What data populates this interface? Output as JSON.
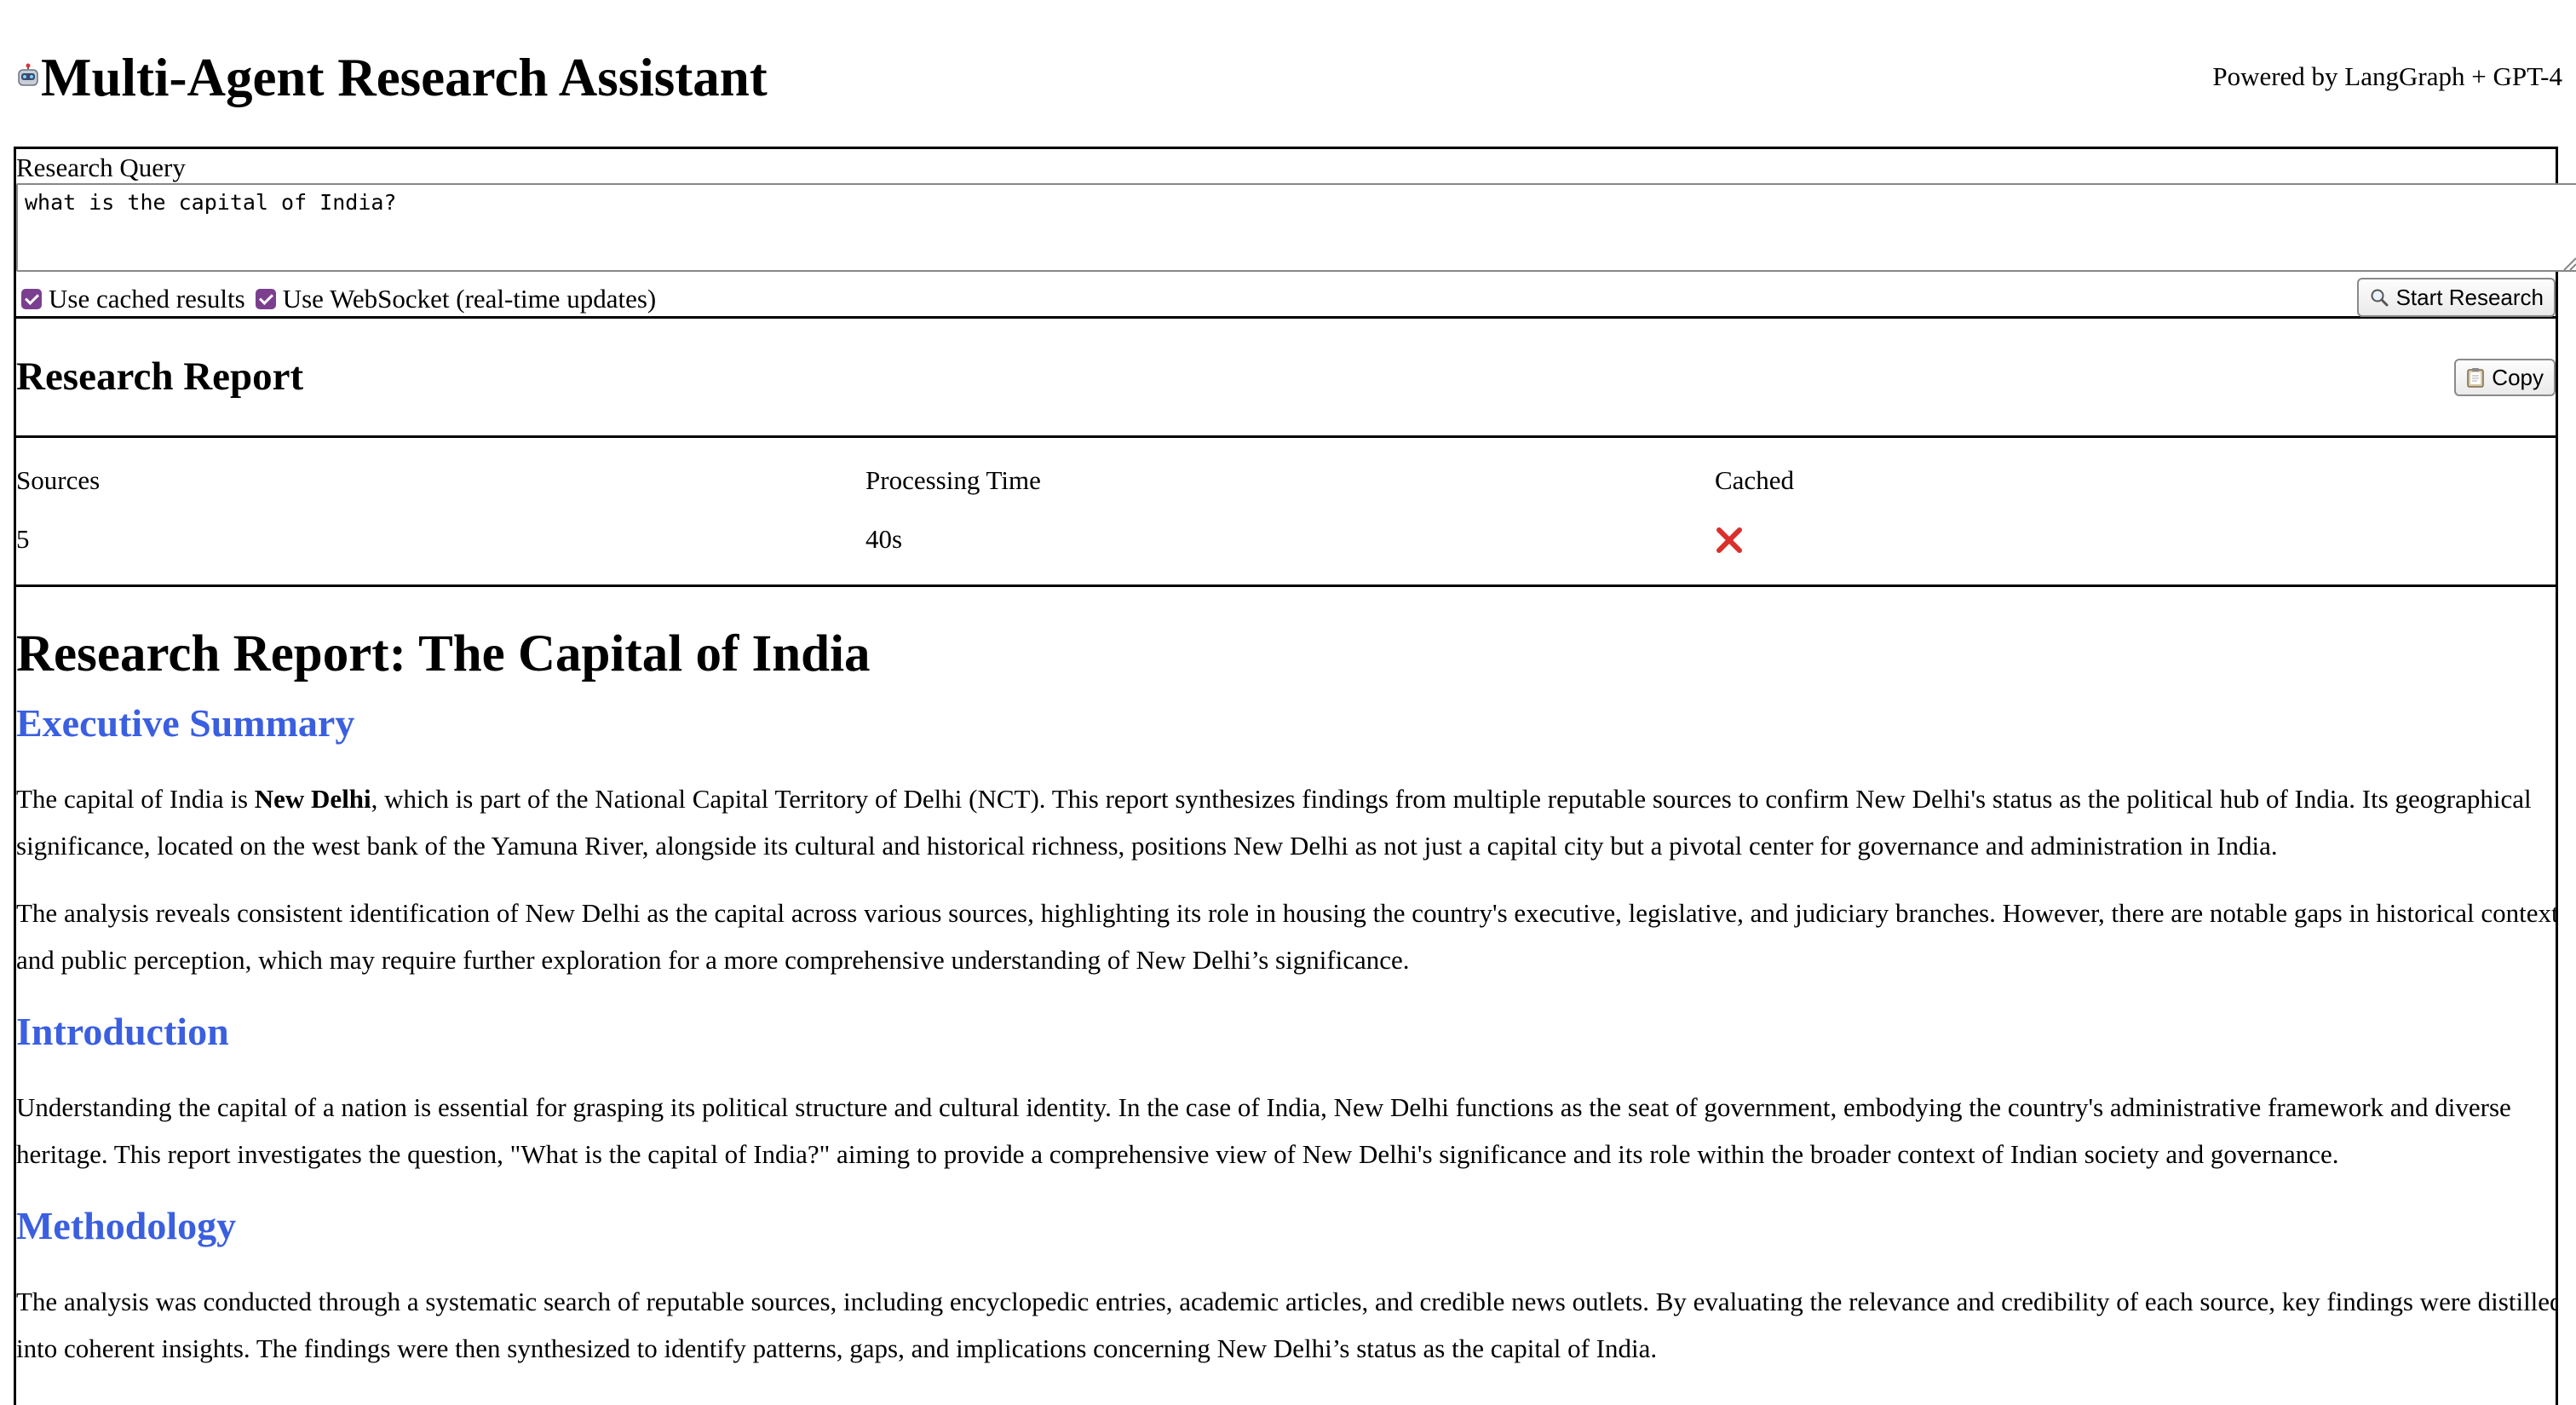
{
  "header": {
    "logo": "robot-icon",
    "title": "Multi-Agent Research Assistant",
    "powered_by": "Powered by LangGraph + GPT-4"
  },
  "query": {
    "label": "Research Query",
    "value": "what is the capital of India?",
    "options": [
      {
        "label": "Use cached results",
        "checked": true
      },
      {
        "label": "Use WebSocket (real-time updates)",
        "checked": true
      }
    ],
    "submit_label": "Start Research",
    "submit_icon": "magnifier-icon"
  },
  "report_header": {
    "title": "Research Report",
    "copy_label": "Copy",
    "copy_icon": "clipboard-icon"
  },
  "stats": {
    "sources_label": "Sources",
    "sources_value": "5",
    "time_label": "Processing Time",
    "time_value": "40s",
    "cached_label": "Cached",
    "cached_icon": "cross-mark-icon",
    "cached_color": "#d9302c"
  },
  "report": {
    "title": "Research Report: The Capital of India",
    "accent_color": "#3a5fe0",
    "sections": [
      {
        "heading": "Executive Summary",
        "paragraphs": [
          {
            "before": "The capital of India is ",
            "bold": "New Delhi",
            "after": ", which is part of the National Capital Territory of Delhi (NCT). This report synthesizes findings from multiple reputable sources to confirm New Delhi's status as the political hub of India. Its geographical significance, located on the west bank of the Yamuna River, alongside its cultural and historical richness, positions New Delhi as not just a capital city but a pivotal center for governance and administration in India."
          },
          {
            "text": "The analysis reveals consistent identification of New Delhi as the capital across various sources, highlighting its role in housing the country's executive, legislative, and judiciary branches. However, there are notable gaps in historical context and public perception, which may require further exploration for a more comprehensive understanding of New Delhi’s significance."
          }
        ]
      },
      {
        "heading": "Introduction",
        "paragraphs": [
          {
            "text": "Understanding the capital of a nation is essential for grasping its political structure and cultural identity. In the case of India, New Delhi functions as the seat of government, embodying the country's administrative framework and diverse heritage. This report investigates the question, \"What is the capital of India?\" aiming to provide a comprehensive view of New Delhi's significance and its role within the broader context of Indian society and governance."
          }
        ]
      },
      {
        "heading": "Methodology",
        "paragraphs": [
          {
            "text": "The analysis was conducted through a systematic search of reputable sources, including encyclopedic entries, academic articles, and credible news outlets. By evaluating the relevance and credibility of each source, key findings were distilled into coherent insights. The findings were then synthesized to identify patterns, gaps, and implications concerning New Delhi’s status as the capital of India."
          }
        ]
      }
    ]
  }
}
